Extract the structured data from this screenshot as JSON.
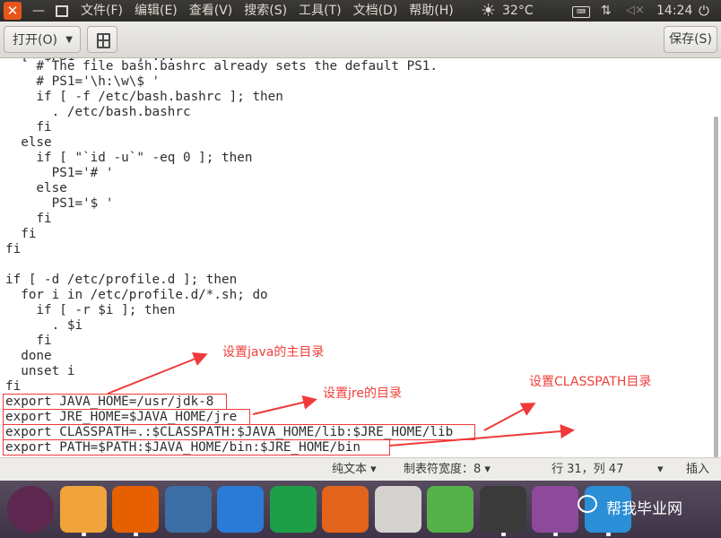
{
  "menubar": {
    "close_symbol": "✕",
    "minimize_symbol": "—",
    "menus": [
      "文件(F)",
      "编辑(E)",
      "查看(V)",
      "搜索(S)",
      "工具(T)",
      "文档(D)",
      "帮助(H)"
    ],
    "temperature": "32°C",
    "clock": "14:24",
    "icons": {
      "weather": "sun-icon",
      "keyboard": "keyboard-icon",
      "network": "network-icon",
      "volume": "volume-muted-icon",
      "power": "power-icon"
    }
  },
  "toolbar": {
    "open_label": "打开(O)",
    "save_label": "保存(S)"
  },
  "editor": {
    "lines": [
      "    # The file bash.bashrc already sets the default PS1.",
      "    # PS1='\\h:\\w\\$ '",
      "    if [ -f /etc/bash.bashrc ]; then",
      "      . /etc/bash.bashrc",
      "    fi",
      "  else",
      "    if [ \"`id -u`\" -eq 0 ]; then",
      "      PS1='# '",
      "    else",
      "      PS1='$ '",
      "    fi",
      "  fi",
      "fi",
      "",
      "if [ -d /etc/profile.d ]; then",
      "  for i in /etc/profile.d/*.sh; do",
      "    if [ -r $i ]; then",
      "      . $i",
      "    fi",
      "  done",
      "  unset i",
      "fi",
      "export JAVA_HOME=/usr/jdk-8",
      "export JRE_HOME=$JAVA_HOME/jre",
      "export CLASSPATH=.:$CLASSPATH:$JAVA_HOME/lib:$JRE_HOME/lib",
      "export PATH=$PATH:$JAVA_HOME/bin:$JRE_HOME/bin"
    ]
  },
  "annotations": {
    "java_home": "设置java的主目录",
    "jre_home": "设置jre的目录",
    "classpath": "设置CLASSPATH目录",
    "color": "#f03a3a"
  },
  "statusbar": {
    "syntax": "纯文本 ▾",
    "tab_width": "制表符宽度：8 ▾",
    "position": "行 31，列 47",
    "position_menu": "▾",
    "insert_mode": "插入"
  },
  "dock": {
    "items": [
      {
        "icon": "ubuntu-dash-icon",
        "color": "#5e2750"
      },
      {
        "icon": "files-icon",
        "color": "#f1a33c"
      },
      {
        "icon": "firefox-icon",
        "color": "#e66000"
      },
      {
        "icon": "browser-icon",
        "color": "#3a6ea5"
      },
      {
        "icon": "writer-icon",
        "color": "#2b7bd6"
      },
      {
        "icon": "calc-icon",
        "color": "#1f9e48"
      },
      {
        "icon": "impress-icon",
        "color": "#e2631c"
      },
      {
        "icon": "software-center-icon",
        "color": "#d4d2ce"
      },
      {
        "icon": "update-icon",
        "color": "#55b24a"
      },
      {
        "icon": "terminal-icon",
        "color": "#3a3a3a"
      },
      {
        "icon": "gedit-icon",
        "color": "#8e4a9a"
      },
      {
        "icon": "settings-icon",
        "color": "#2a8fd6"
      }
    ],
    "watermark": "帮我毕业网"
  }
}
